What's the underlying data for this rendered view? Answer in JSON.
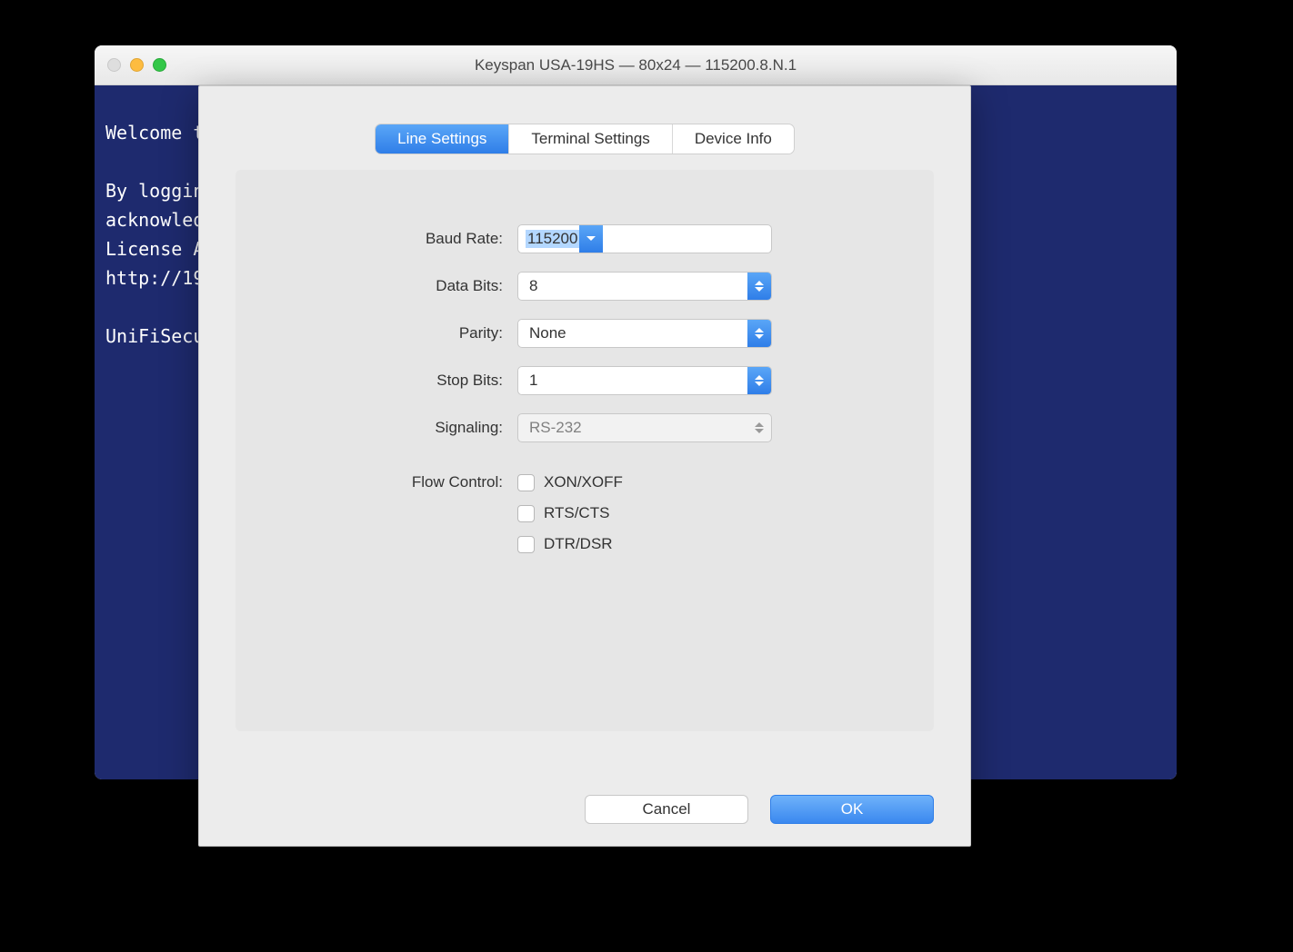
{
  "window": {
    "title": "Keyspan USA-19HS — 80x24 — 115200.8.N.1"
  },
  "terminal": {
    "lines": "Welcome t\n\nBy loggin\nacknowled\nLicense A\nhttp://19\n\nUniFiSecu"
  },
  "tabs": {
    "line_settings": "Line Settings",
    "terminal_settings": "Terminal Settings",
    "device_info": "Device Info"
  },
  "form": {
    "baud_rate": {
      "label": "Baud Rate:",
      "value": "115200"
    },
    "data_bits": {
      "label": "Data Bits:",
      "value": "8"
    },
    "parity": {
      "label": "Parity:",
      "value": "None"
    },
    "stop_bits": {
      "label": "Stop Bits:",
      "value": "1"
    },
    "signaling": {
      "label": "Signaling:",
      "value": "RS-232"
    },
    "flow_control": {
      "label": "Flow Control:",
      "xon_xoff": "XON/XOFF",
      "rts_cts": "RTS/CTS",
      "dtr_dsr": "DTR/DSR"
    }
  },
  "buttons": {
    "cancel": "Cancel",
    "ok": "OK"
  }
}
